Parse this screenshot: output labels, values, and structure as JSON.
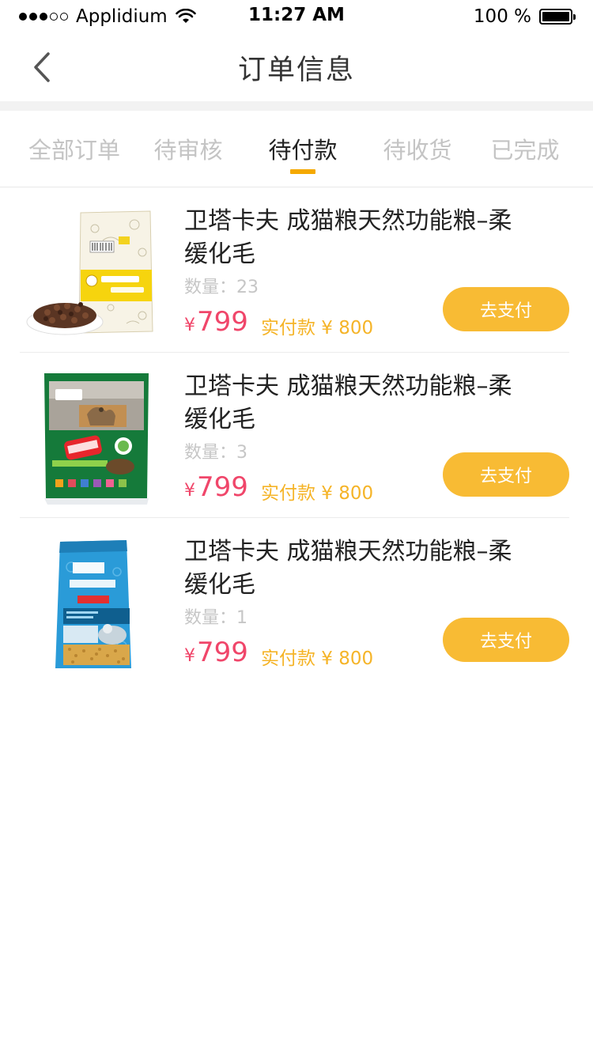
{
  "status_bar": {
    "carrier": "Applidium",
    "time": "11:27 AM",
    "battery_text": "100 %",
    "signal_dots_filled": 3,
    "signal_dots_total": 5
  },
  "nav": {
    "back_icon": "chevron-left-icon",
    "title": "订单信息"
  },
  "tabs": [
    {
      "label": "全部订单",
      "active": false
    },
    {
      "label": "待审核",
      "active": false
    },
    {
      "label": "待付款",
      "active": true
    },
    {
      "label": "待收货",
      "active": false
    },
    {
      "label": "已完成",
      "active": false
    }
  ],
  "colors": {
    "accent": "#f5a900",
    "price": "#f0466a",
    "paid_text": "#f5b428",
    "button": "#f8bb34"
  },
  "orders": [
    {
      "name": "卫塔卡夫 成猫粮天然功能粮–柔缓化毛",
      "quantity": "数量：23",
      "price_symbol": "¥",
      "price": "799",
      "paid": "实付款 ¥ 800",
      "button": "去支付",
      "image": "cat-food-bag-yellow"
    },
    {
      "name": "卫塔卡夫 成猫粮天然功能粮–柔缓化毛",
      "quantity": "数量：3",
      "price_symbol": "¥",
      "price": "799",
      "paid": "实付款 ¥ 800",
      "button": "去支付",
      "image": "cat-food-bag-green"
    },
    {
      "name": "卫塔卡夫 成猫粮天然功能粮–柔缓化毛",
      "quantity": "数量：1",
      "price_symbol": "¥",
      "price": "799",
      "paid": "实付款 ¥ 800",
      "button": "去支付",
      "image": "cat-food-bag-blue"
    }
  ]
}
